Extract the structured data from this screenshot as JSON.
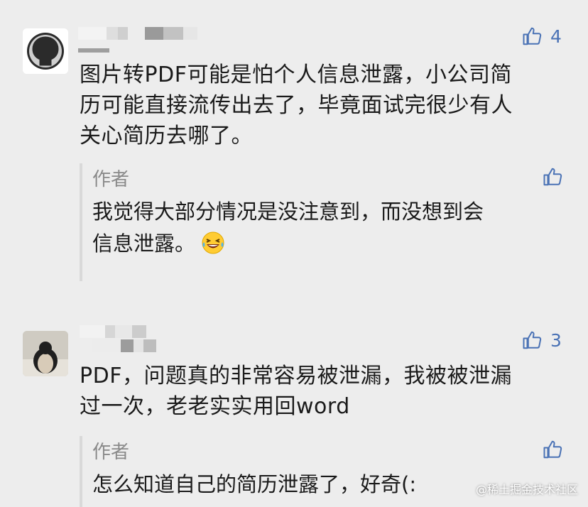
{
  "comments": [
    {
      "likes": "4",
      "text_lines": [
        "图片转PDF可能是怕个人信息泄露，小公司简",
        "历可能直接流传出去了，毕竟面试完很少有人",
        "关心简历去哪了。"
      ],
      "reply": {
        "author": "作者",
        "text_lines": [
          "我觉得大部分情况是没注意到，而没想到会",
          "信息泄露。"
        ]
      }
    },
    {
      "likes": "3",
      "text_lines": [
        "PDF，问题真的非常容易被泄漏，我被被泄漏",
        "过一次，老老实实用回word"
      ],
      "reply": {
        "author": "作者",
        "text_lines": [
          "怎么知道自己的简历泄露了，好奇(:"
        ]
      }
    }
  ],
  "watermark": "@稀土掘金技术社区",
  "colors": {
    "like_blue": "#4a72b5",
    "background": "#ededed",
    "reply_bar": "#d9d9d9"
  },
  "icons": [
    "github-avatar-icon",
    "thumbs-up-icon",
    "laughing-emoji-icon"
  ]
}
